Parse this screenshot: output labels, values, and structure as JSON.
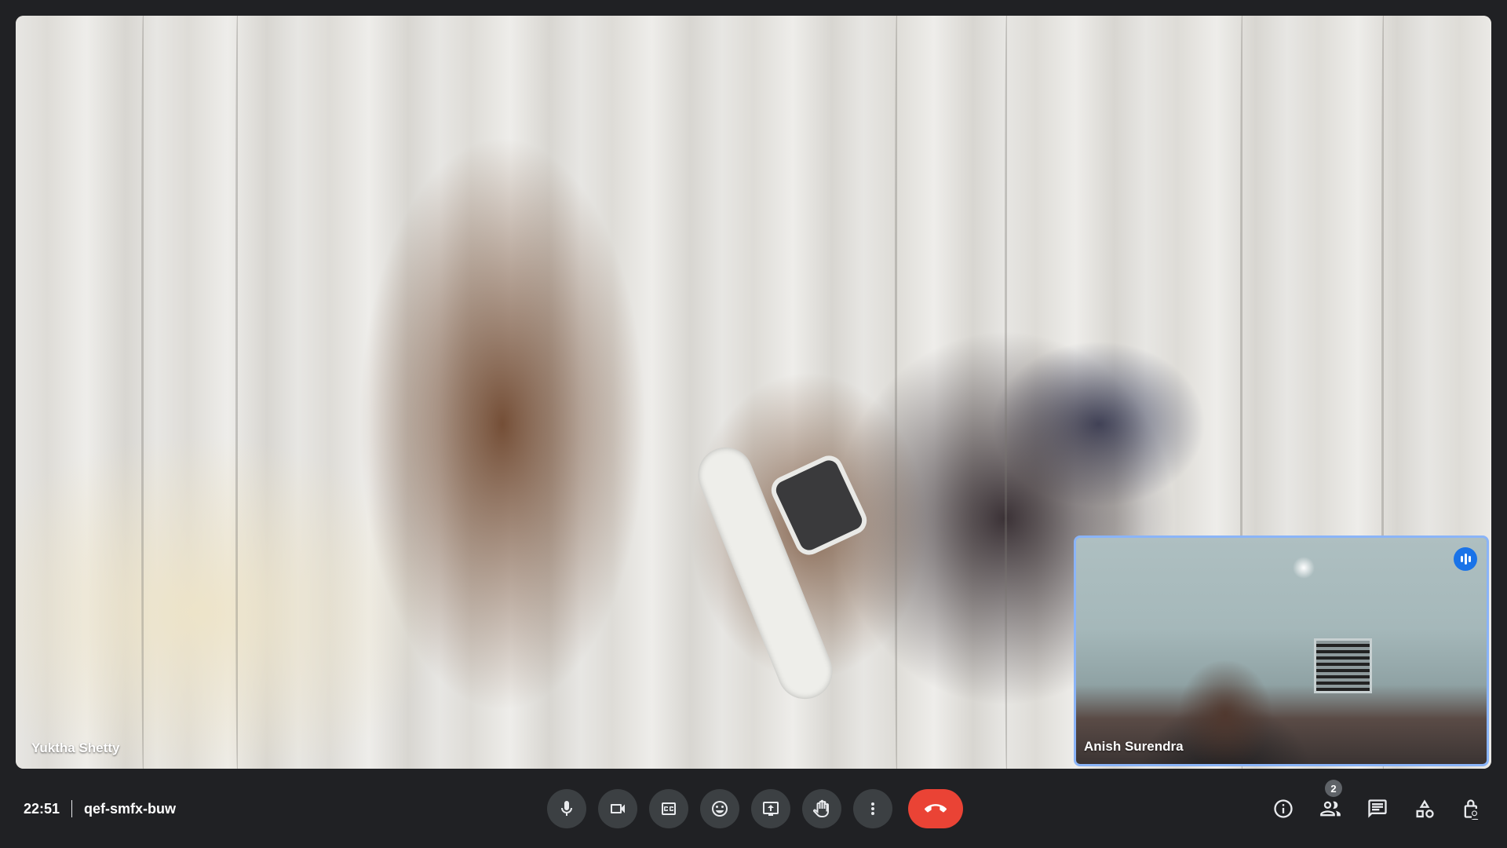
{
  "main_participant": {
    "name": "Yuktha Shetty"
  },
  "self_view": {
    "name": "Anish Surendra",
    "speaking": true
  },
  "meeting": {
    "time": "22:51",
    "code": "qef-smfx-buw"
  },
  "controls": [
    {
      "name": "microphone-button",
      "icon": "mic-icon"
    },
    {
      "name": "camera-button",
      "icon": "videocam-icon"
    },
    {
      "name": "captions-button",
      "icon": "closed-caption-icon"
    },
    {
      "name": "reactions-button",
      "icon": "emoji-icon"
    },
    {
      "name": "present-button",
      "icon": "present-screen-icon"
    },
    {
      "name": "raise-hand-button",
      "icon": "hand-icon"
    },
    {
      "name": "more-options-button",
      "icon": "more-vert-icon"
    },
    {
      "name": "end-call-button",
      "icon": "call-end-icon",
      "color": "#ea4335"
    }
  ],
  "right_panel": {
    "people_count": "2",
    "icons": [
      "info-icon",
      "people-icon",
      "chat-icon",
      "activities-icon",
      "host-controls-icon"
    ]
  },
  "colors": {
    "background": "#202124",
    "button": "#3c4043",
    "end_call": "#ea4335",
    "speaking_border": "#8ab4f8",
    "speaking_badge": "#1a73e8"
  }
}
